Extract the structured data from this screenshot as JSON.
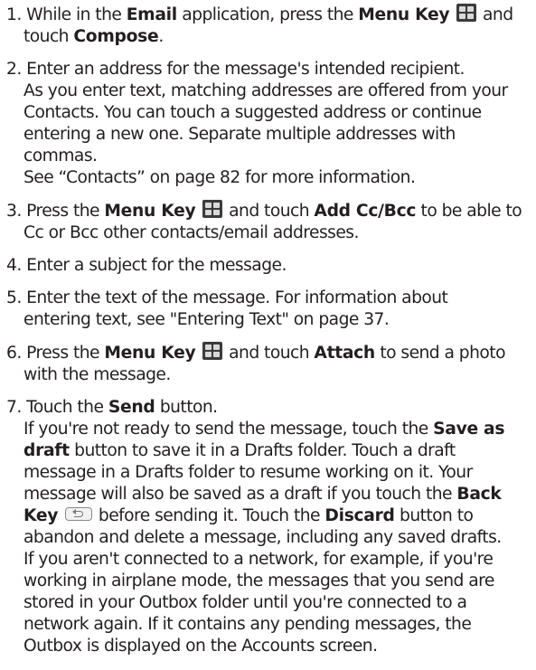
{
  "steps": [
    {
      "number": "1.",
      "lines": [
        {
          "t1": "While in the ",
          "b1": "Email",
          "t2": " application, press the ",
          "b2": "Menu Key",
          "t3": " and"
        },
        {
          "t1": "touch ",
          "b1": "Compose",
          "t2": "."
        }
      ]
    },
    {
      "number": "2.",
      "lines": [
        "Enter an address for the message's intended recipient.",
        "As you enter text, matching addresses are offered from your",
        "Contacts. You can touch a suggested address or continue",
        "entering a new one. Separate multiple addresses with",
        "commas.",
        "See “Contacts” on page 82 for more information."
      ]
    },
    {
      "number": "3.",
      "lines": [
        {
          "t1": "Press the ",
          "b1": "Menu Key",
          "t2": " and touch ",
          "b2": "Add Cc/Bcc",
          "t3": " to be able to"
        },
        "Cc or Bcc other contacts/email addresses."
      ]
    },
    {
      "number": "4.",
      "lines": [
        "Enter a subject for the message."
      ]
    },
    {
      "number": "5.",
      "lines": [
        "Enter the text of the message. For information about",
        "entering text, see \"Entering Text\" on page 37."
      ]
    },
    {
      "number": "6.",
      "lines": [
        {
          "t1": "Press the ",
          "b1": "Menu Key",
          "t2": " and touch ",
          "b2": "Attach",
          "t3": " to send a photo"
        },
        "with the message."
      ]
    },
    {
      "number": "7.",
      "lines": [
        {
          "t1": "Touch the ",
          "b1": "Send",
          "t2": " button."
        },
        {
          "t1": "If you're not ready to send the message, touch the ",
          "b1": "Save as"
        },
        {
          "b1": "draft",
          "t1": " button to save it in a Drafts folder. Touch a draft"
        },
        "message in a Drafts folder to resume working on it. Your",
        {
          "t1": "message will also be saved as a draft if you touch the ",
          "b1": "Back"
        },
        {
          "b1": "Key",
          "t1": " before sending it. Touch the ",
          "b2": "Discard",
          "t2": " button to"
        },
        "abandon and delete a message, including any saved drafts.",
        "If you aren't connected to a network, for example, if you're",
        "working in airplane mode, the messages that you send are",
        "stored in your Outbox folder until you're connected to a",
        "network again. If it contains any pending messages, the",
        "Outbox is displayed on the Accounts screen."
      ]
    }
  ],
  "icons": {
    "menu_key": "menu-key-icon",
    "back_key": "back-key-icon"
  }
}
